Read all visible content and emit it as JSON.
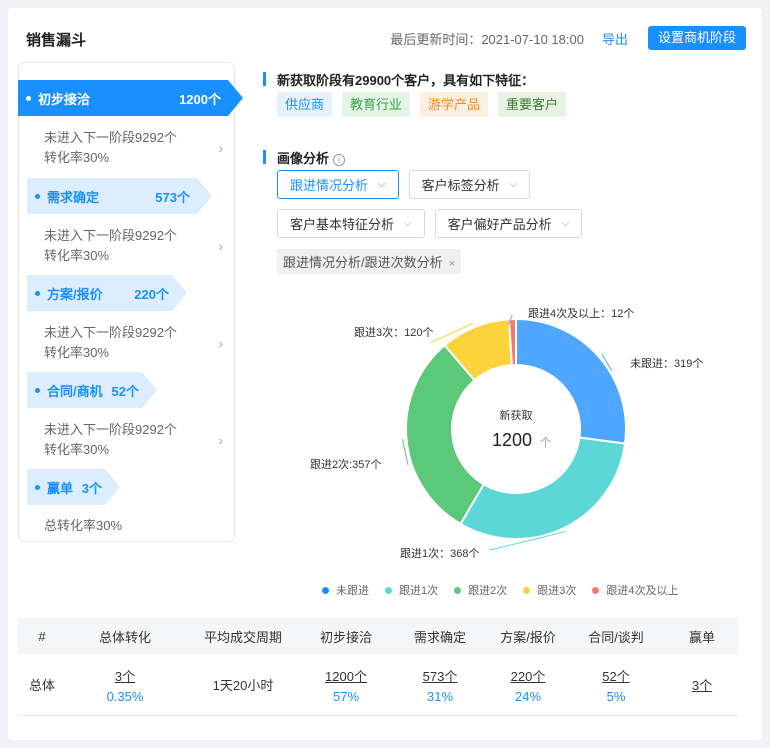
{
  "header": {
    "title": "销售漏斗",
    "updated": "最后更新时间：2021-07-10 18:00",
    "export_label": "导出",
    "set_stage_label": "设置商机阶段"
  },
  "funnel": {
    "stages": [
      {
        "name": "初步接洽",
        "count": "1200个",
        "detail1": "未进入下一阶段9292个",
        "detail2": "转化率30%"
      },
      {
        "name": "需求确定",
        "count": "573个",
        "detail1": "未进入下一阶段9292个",
        "detail2": "转化率30%"
      },
      {
        "name": "方案/报价",
        "count": "220个",
        "detail1": "未进入下一阶段9292个",
        "detail2": "转化率30%"
      },
      {
        "name": "合同/商机",
        "count": "52个",
        "detail1": "未进入下一阶段9292个",
        "detail2": "转化率30%"
      },
      {
        "name": "赢单",
        "count": "3个",
        "detail1": "总转化率30%",
        "detail2": ""
      }
    ]
  },
  "features": {
    "title": "新获取阶段有29900个客户，具有如下特征：",
    "tags": [
      {
        "label": "供应商",
        "bg": "#e6f1fd",
        "color": "#1890ff"
      },
      {
        "label": "教育行业",
        "bg": "#e4f5e6",
        "color": "#36a047"
      },
      {
        "label": "游学产品",
        "bg": "#fdf0e0",
        "color": "#f08a24"
      },
      {
        "label": "重要客户",
        "bg": "#e7f2e4",
        "color": "#3d7a2e"
      }
    ]
  },
  "analysis": {
    "title": "画像分析",
    "info_icon": "info-icon",
    "selects": [
      "跟进情况分析",
      "客户标签分析",
      "客户基本特征分析",
      "客户偏好产品分析"
    ],
    "filter_chip": "跟进情况分析/跟进次数分析"
  },
  "chart_data": {
    "type": "pie",
    "center_title": "新获取",
    "center_value": "1200",
    "center_unit": "个",
    "slices": [
      {
        "name": "未跟进",
        "value": 319,
        "label": "未跟进：319个",
        "color": "#4da6ff"
      },
      {
        "name": "跟进1次",
        "value": 368,
        "label": "跟进1次：368个",
        "color": "#5dd6d6"
      },
      {
        "name": "跟进2次",
        "value": 357,
        "label": "跟进2次:357个",
        "color": "#5cc879"
      },
      {
        "name": "跟进3次",
        "value": 120,
        "label": "跟进3次：120个",
        "color": "#fcd33a"
      },
      {
        "name": "跟进4次及以上",
        "value": 12,
        "label": "跟进4次及以上：12个",
        "color": "#f07b7b"
      }
    ],
    "legend": [
      "未跟进",
      "跟进1次",
      "跟进2次",
      "跟进3次",
      "跟进4次及以上"
    ]
  },
  "table": {
    "headers": [
      "#",
      "总体转化",
      "平均成交周期",
      "初步接洽",
      "需求确定",
      "方案/报价",
      "合同/谈判",
      "赢单"
    ],
    "row": {
      "label": "总体",
      "total_count": "3个",
      "total_rate": "0.35%",
      "cycle": "1天20小时",
      "s1_count": "1200个",
      "s1_rate": "57%",
      "s2_count": "573个",
      "s2_rate": "31%",
      "s3_count": "220个",
      "s3_rate": "24%",
      "s4_count": "52个",
      "s4_rate": "5%",
      "win_count": "3个"
    }
  }
}
